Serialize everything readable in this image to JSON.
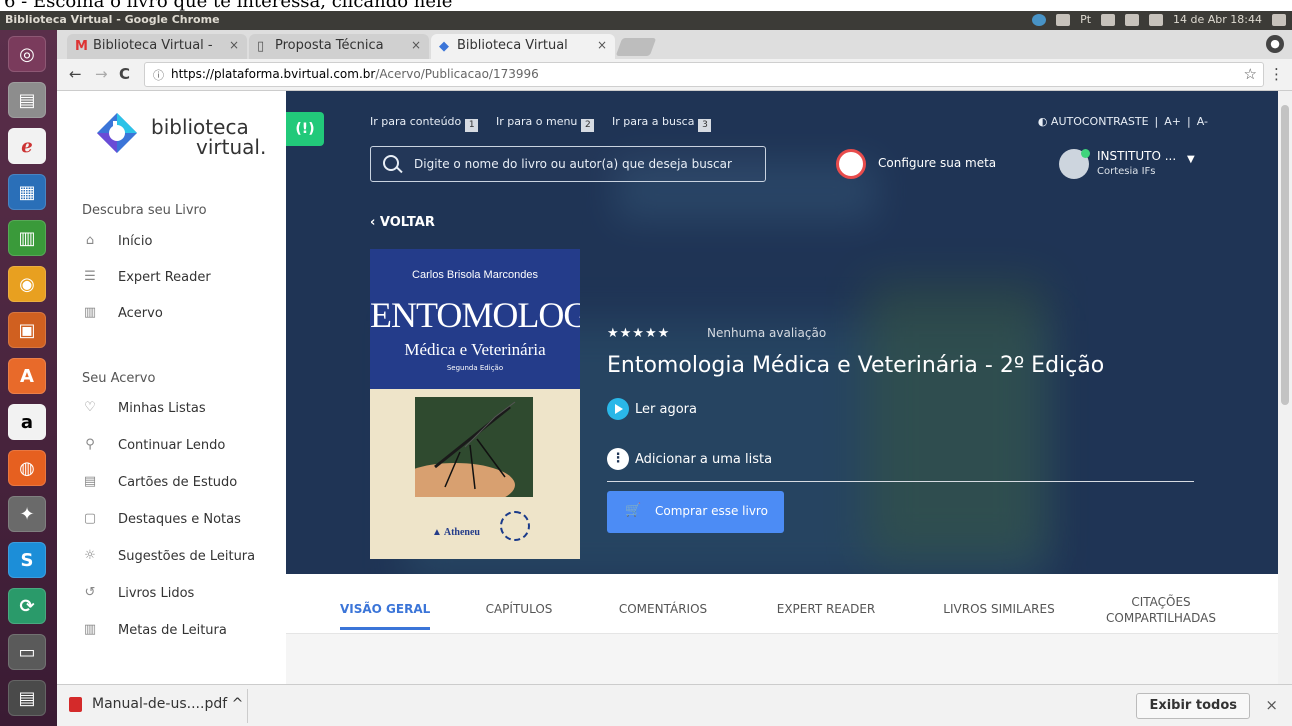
{
  "caption": "6 - Escolha o livro que te interessa, clicando nele",
  "os": {
    "window_title": "Biblioteca Virtual - Google Chrome",
    "clock": "14 de Abr 18:44",
    "keyboard": "Pt"
  },
  "browser": {
    "tabs": [
      {
        "label": "Biblioteca Virtual -",
        "icon": "gmail-icon"
      },
      {
        "label": "Proposta Técnica",
        "icon": "doc-icon"
      },
      {
        "label": "Biblioteca Virtual",
        "icon": "bvirtual-icon"
      }
    ],
    "url_host": "https://plataforma.bvirtual.com.br",
    "url_path": "/Acervo/Publicacao/173996"
  },
  "brand": {
    "line1": "biblioteca",
    "line2": "virtual."
  },
  "nav": {
    "section1": "Descubra seu Livro",
    "items1": [
      {
        "label": "Início",
        "icon": "home-icon"
      },
      {
        "label": "Expert Reader",
        "icon": "list-icon"
      },
      {
        "label": "Acervo",
        "icon": "books-icon"
      }
    ],
    "section2": "Seu Acervo",
    "items2": [
      {
        "label": "Minhas Listas",
        "icon": "heart-icon"
      },
      {
        "label": "Continuar Lendo",
        "icon": "reader-icon"
      },
      {
        "label": "Cartões de Estudo",
        "icon": "card-icon"
      },
      {
        "label": "Destaques e Notas",
        "icon": "note-icon"
      },
      {
        "label": "Sugestões de Leitura",
        "icon": "bulb-icon"
      },
      {
        "label": "Livros Lidos",
        "icon": "history-icon"
      },
      {
        "label": "Metas de Leitura",
        "icon": "chart-icon"
      }
    ]
  },
  "header": {
    "alert": "(!)",
    "skip": [
      {
        "label": "Ir para conteúdo",
        "key": "1"
      },
      {
        "label": "Ir para o menu",
        "key": "2"
      },
      {
        "label": "Ir para a busca",
        "key": "3"
      }
    ],
    "contrast": "AUTOCONTRASTE",
    "font_up": "A+",
    "font_down": "A-",
    "search_placeholder": "Digite o nome do livro ou autor(a) que deseja buscar",
    "goal": "Configure sua meta",
    "user_name": "INSTITUTO ...",
    "user_sub": "Cortesia IFs"
  },
  "book": {
    "back": "VOLTAR",
    "cover_author": "Carlos Brisola Marcondes",
    "cover_title": "ENTOMOLOGIA",
    "cover_subtitle": "Médica e Veterinária",
    "cover_edition": "Segunda Edição",
    "cover_publisher": "Atheneu",
    "stars": "★★★★★",
    "rating": "Nenhuma avaliação",
    "title": "Entomologia Médica e Veterinária - 2º Edição",
    "read_now": "Ler agora",
    "add_list": "Adicionar a uma lista",
    "buy": "Comprar esse livro"
  },
  "content_tabs": [
    "VISÃO GERAL",
    "CAPÍTULOS",
    "COMENTÁRIOS",
    "EXPERT READER",
    "LIVROS SIMILARES",
    "CITAÇÕES",
    "COMPARTILHADAS"
  ],
  "downloads": {
    "file": "Manual-de-us....pdf",
    "show_all": "Exibir todos"
  },
  "colors": {
    "hero_bg": "#1f3455",
    "accent": "#3b75d8",
    "buy": "#4c8cf5",
    "alert": "#22c97a"
  }
}
